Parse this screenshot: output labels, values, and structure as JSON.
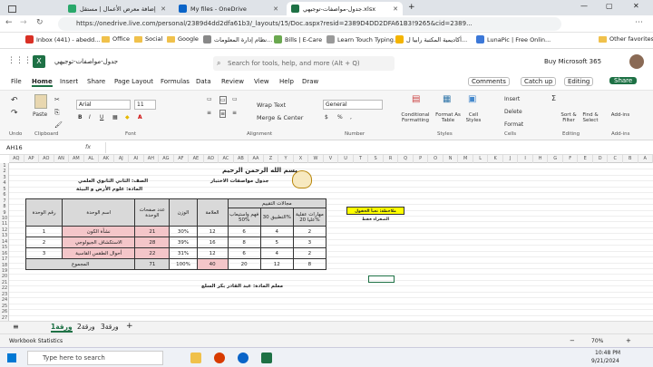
{
  "browser": {
    "tabs": [
      {
        "label": "إضافة معرض الأعمال | مستقل",
        "color": "#2aa86b"
      },
      {
        "label": "My files - OneDrive",
        "color": "#0a64c8"
      },
      {
        "label": "جدول-مواصفات-توجيهي.xlsx",
        "color": "#1e7145"
      }
    ],
    "url": "https://onedrive.live.com/personal/2389d4dd2dfa61b3/_layouts/15/Doc.aspx?resid=2389D4DD2DFA61B3!9265&cid=2389...",
    "bookmarks": [
      "Inbox (441) - abedd...",
      "Office",
      "Social",
      "Google",
      "نظام إدارة المعلومات...",
      "Bills | E-Care",
      "Learn Touch Typing...",
      "أكاديمية المكتبة رابيا ل...",
      "LunaPic | Free Onlin...",
      "Other favorites"
    ]
  },
  "office": {
    "doc_title": "جدول-مواصفات-توجيهي",
    "search_placeholder": "Search for tools, help, and more (Alt + Q)",
    "buy": "Buy Microsoft 365",
    "ribbon_tabs": [
      "File",
      "Home",
      "Insert",
      "Share",
      "Page Layout",
      "Formulas",
      "Data",
      "Review",
      "View",
      "Help",
      "Draw"
    ],
    "comments": "Comments",
    "catchup": "Catch up",
    "editing": "Editing",
    "share": "Share",
    "font": "Arial",
    "size": "11",
    "number_format": "General",
    "groups": {
      "undo": "Undo",
      "clipboard": "Clipboard",
      "font": "Font",
      "alignment": "Alignment",
      "number": "Number",
      "styles": "Styles",
      "cells": "Cells",
      "editing": "Editing",
      "addins": "Add-ins"
    },
    "buttons": {
      "paste": "Paste",
      "wrap": "Wrap Text",
      "merge": "Merge & Center",
      "cond": "Conditional Formatting",
      "fmt_table": "Format As Table",
      "cell_styles": "Cell Styles",
      "insert": "Insert",
      "delete": "Delete",
      "format": "Format",
      "sort": "Sort & Filter",
      "find": "Find & Select",
      "addins": "Add-ins"
    }
  },
  "formula": {
    "namebox": "AH16",
    "fx": "fx"
  },
  "sheet": {
    "basmala": "بسم الله الرحمن الرحيم",
    "subtitle": "جدول مواصفات الاختبار",
    "class_label": "الصف: الثاني الثانوي العلمي",
    "subject_label": "المادة: علوم الأرض و البيئة",
    "note": "ملاحظة: تعبأ الحقول الصفراء فقط",
    "teacher": "معلم المادة: عبد القادر بكر السلع",
    "headers": {
      "unit_no": "رقم الوحدة",
      "unit_name": "اسم الوحدة",
      "pages": "عدد صفحات الوحدة",
      "weight": "الوزن",
      "marks": "العلامة",
      "levels": "مجالات التقييم",
      "understand": "فهم واستيعاب 50%",
      "apply": "التطبيق 30%",
      "higher": "مهارات عقلية عليا 20%"
    },
    "rows": [
      {
        "no": "1",
        "name": "نشأة الكون",
        "pages": "21",
        "weight": "30%",
        "marks": "12",
        "u": "6",
        "a": "4",
        "h": "2"
      },
      {
        "no": "2",
        "name": "الاستكشاف الجيولوجي",
        "pages": "28",
        "weight": "39%",
        "marks": "16",
        "u": "8",
        "a": "5",
        "h": "3"
      },
      {
        "no": "3",
        "name": "أحوال الطقس القاسية",
        "pages": "22",
        "weight": "31%",
        "marks": "12",
        "u": "6",
        "a": "4",
        "h": "2"
      }
    ],
    "total": {
      "label": "المجموع",
      "pages": "71",
      "weight": "100%",
      "marks": "40",
      "u": "20",
      "a": "12",
      "h": "8"
    },
    "columns": [
      "A",
      "B",
      "C",
      "D",
      "E",
      "F",
      "G",
      "H",
      "I",
      "J",
      "K",
      "L",
      "M",
      "N",
      "O",
      "P",
      "Q",
      "R",
      "S",
      "T",
      "U",
      "V",
      "W",
      "X",
      "Y",
      "Z",
      "AA",
      "AB",
      "AC",
      "AD",
      "AE",
      "AF",
      "AG",
      "AH",
      "AI",
      "AJ",
      "AK",
      "AL",
      "AM",
      "AN",
      "AO",
      "AP",
      "AQ"
    ],
    "row_numbers": [
      "1",
      "2",
      "3",
      "4",
      "5",
      "6",
      "7",
      "8",
      "9",
      "10",
      "11",
      "12",
      "13",
      "14",
      "15",
      "16",
      "17",
      "18",
      "19",
      "20",
      "21",
      "22",
      "23",
      "24",
      "25",
      "26",
      "27"
    ]
  },
  "sheets": {
    "tabs": [
      "ورقة1",
      "ورقة2",
      "ورقة3"
    ],
    "add": "+"
  },
  "status": {
    "left": "Workbook Statistics",
    "zoom": "70%"
  },
  "taskbar": {
    "search": "Type here to search",
    "time": "10:48 PM",
    "date": "9/21/2024"
  }
}
